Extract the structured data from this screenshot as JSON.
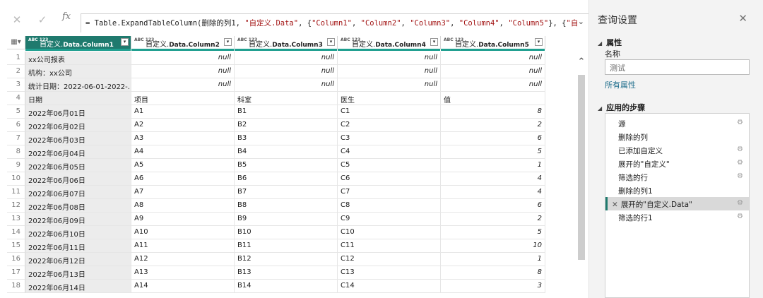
{
  "formula": {
    "cancel_icon": "✕",
    "confirm_icon": "✓",
    "fx_label": "fx",
    "prefix": "= Table.ExpandTableColumn(删除的列1, ",
    "s1": "\"自定义.Data\"",
    "sep1": ", {",
    "s2": "\"Column1\"",
    "sep2": ", ",
    "s3": "\"Column2\"",
    "sep3": ", ",
    "s4": "\"Column3\"",
    "sep4": ", ",
    "s5": "\"Column4\"",
    "sep5": ", ",
    "s6": "\"Column5\"",
    "sep6": "}, {",
    "s7": "\"自"
  },
  "grid": {
    "headers": [
      {
        "type": "ABC\n123",
        "label": "自定义.",
        "bold": "Data.Column1"
      },
      {
        "type": "ABC\n123",
        "label": "自定义.",
        "bold": "Data.Column2"
      },
      {
        "type": "ABC\n123",
        "label": "自定义.",
        "bold": "Data.Column3"
      },
      {
        "type": "ABC\n123",
        "label": "自定义.",
        "bold": "Data.Column4"
      },
      {
        "type": "ABC\n123",
        "label": "自定义.",
        "bold": "Data.Column5"
      }
    ],
    "rows": [
      [
        "1",
        "xx公司报表",
        "null",
        "null",
        "null",
        "null"
      ],
      [
        "2",
        "机构：xx公司",
        "null",
        "null",
        "null",
        "null"
      ],
      [
        "3",
        "统计日期：2022-06-01-2022-...",
        "null",
        "null",
        "null",
        "null"
      ],
      [
        "4",
        "日期",
        "项目",
        "科室",
        "医生",
        "值"
      ],
      [
        "5",
        "2022年06月01日",
        "A1",
        "B1",
        "C1",
        "8"
      ],
      [
        "6",
        "2022年06月02日",
        "A2",
        "B2",
        "C2",
        "2"
      ],
      [
        "7",
        "2022年06月03日",
        "A3",
        "B3",
        "C3",
        "6"
      ],
      [
        "8",
        "2022年06月04日",
        "A4",
        "B4",
        "C4",
        "5"
      ],
      [
        "9",
        "2022年06月05日",
        "A5",
        "B5",
        "C5",
        "1"
      ],
      [
        "10",
        "2022年06月06日",
        "A6",
        "B6",
        "C6",
        "4"
      ],
      [
        "11",
        "2022年06月07日",
        "A7",
        "B7",
        "C7",
        "4"
      ],
      [
        "12",
        "2022年06月08日",
        "A8",
        "B8",
        "C8",
        "6"
      ],
      [
        "13",
        "2022年06月09日",
        "A9",
        "B9",
        "C9",
        "2"
      ],
      [
        "14",
        "2022年06月10日",
        "A10",
        "B10",
        "C10",
        "5"
      ],
      [
        "15",
        "2022年06月11日",
        "A11",
        "B11",
        "C11",
        "10"
      ],
      [
        "16",
        "2022年06月12日",
        "A12",
        "B12",
        "C12",
        "1"
      ],
      [
        "17",
        "2022年06月13日",
        "A13",
        "B13",
        "C13",
        "8"
      ],
      [
        "18",
        "2022年06月14日",
        "A14",
        "B14",
        "C14",
        "3"
      ]
    ]
  },
  "panel": {
    "title": "查询设置",
    "properties_header": "属性",
    "name_label": "名称",
    "name_value": "测试",
    "all_properties": "所有属性",
    "steps_header": "应用的步骤",
    "steps": [
      {
        "label": "源",
        "gear": true
      },
      {
        "label": "删除的列",
        "gear": false
      },
      {
        "label": "已添加自定义",
        "gear": true
      },
      {
        "label": "展开的\"自定义\"",
        "gear": true
      },
      {
        "label": "筛选的行",
        "gear": true
      },
      {
        "label": "删除的列1",
        "gear": false
      },
      {
        "label": "展开的\"自定义.Data\"",
        "gear": true,
        "selected": true
      },
      {
        "label": "筛选的行1",
        "gear": true
      }
    ]
  },
  "colors": {
    "accent": "#1f7a6e",
    "quality_bar": "#1f9f8f",
    "string_literal": "#a31515"
  }
}
